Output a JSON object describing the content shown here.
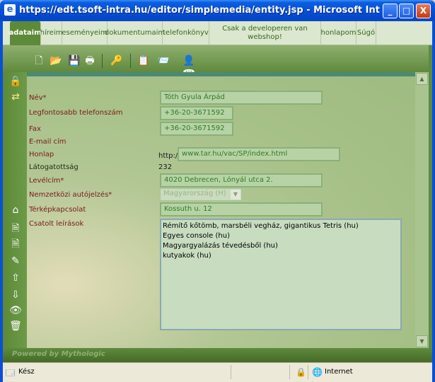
{
  "window": {
    "title": "https://edt.tsoft-intra.hu/editor/simplemedia/entity.jsp - Microsoft Internet Exp...",
    "minimize": "_",
    "maximize": "□",
    "close": "X"
  },
  "nav": {
    "items": [
      {
        "label": "adataim",
        "active": true
      },
      {
        "label": "híreim"
      },
      {
        "label": "eseményeim"
      },
      {
        "label": "dokumentumaim"
      },
      {
        "label": "telefonkönyv"
      },
      {
        "label": "Csak a developeren van webshop!"
      },
      {
        "label": "honlapom"
      },
      {
        "label": "Súgó"
      }
    ]
  },
  "toolbar": {
    "icons": [
      "new-document-icon",
      "open-folder-icon",
      "save-icon",
      "print-icon",
      "key-icon",
      "document-list-icon",
      "folder-envelope-icon",
      "user-phone-icon"
    ]
  },
  "sidebar": {
    "icons": [
      "lock-icon",
      "arrows-icon",
      "home-icon",
      "page-icon",
      "page-add-icon",
      "page-edit-icon",
      "page-up-icon",
      "page-down-icon",
      "page-view-icon",
      "page-delete-icon"
    ]
  },
  "form": {
    "nev_label": "Név*",
    "nev_value": "Tóth Gyula Árpád",
    "telefon_label": "Legfontosabb telefonszám",
    "telefon_value": "+36-20-3671592",
    "fax_label": "Fax",
    "fax_value": "+36-20-3671592",
    "email_label": "E-mail cím",
    "honlap_label": "Honlap",
    "honlap_prefix": "http://",
    "honlap_value": "www.tar.hu/vac/SP/index.html",
    "latogatottsag_label": "Látogatottság",
    "latogatottsag_value": "232",
    "levelcim_label": "Levélcím*",
    "levelcim_value": "4020 Debrecen, Lónyál utca 2.",
    "autojelzes_label": "Nemzetközi autójelzés*",
    "autojelzes_value": "Magyarország (H)",
    "terkep_label": "Térképkapcsolat",
    "terkep_value": "Kossuth u. 12",
    "leiras_label": "Csatolt leírások",
    "leiras_items": [
      "Rémítő kőtömb, marsbéli vegház, gigantikus Tetris (hu)",
      "Egyes console (hu)",
      "Magyargyalázás tévedésből (hu)",
      "kutyakok (hu)"
    ]
  },
  "footer": {
    "powered": "Powered by Mythologic"
  },
  "status": {
    "text": "Kész",
    "zone": "Internet"
  },
  "colors": {
    "accent": "#5f8a3d",
    "label_red": "#7a1a1a",
    "field_text": "#2f7b27",
    "titlebar": "#0550d8"
  }
}
